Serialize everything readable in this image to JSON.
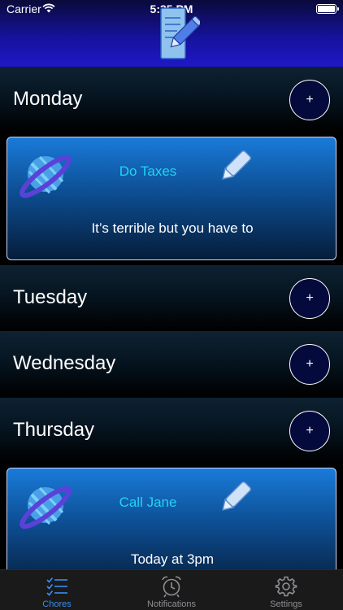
{
  "status_bar": {
    "carrier": "Carrier",
    "time": "5:35 PM"
  },
  "header": {
    "logo_icon": "notepad-pencil-icon"
  },
  "days": [
    {
      "name": "Monday",
      "add_label": "+",
      "chores": [
        {
          "title": "Do Taxes",
          "description": "It’s terrible but you have to"
        }
      ]
    },
    {
      "name": "Tuesday",
      "add_label": "+",
      "chores": []
    },
    {
      "name": "Wednesday",
      "add_label": "+",
      "chores": []
    },
    {
      "name": "Thursday",
      "add_label": "+",
      "chores": [
        {
          "title": "Call Jane",
          "description": "Today at 3pm"
        }
      ]
    }
  ],
  "tabbar": {
    "tabs": [
      {
        "label": "Chores",
        "icon": "checklist-icon",
        "active": true
      },
      {
        "label": "Notifications",
        "icon": "alarm-clock-icon",
        "active": false
      },
      {
        "label": "Settings",
        "icon": "gear-icon",
        "active": false
      }
    ]
  },
  "colors": {
    "accent": "#3b8cf0",
    "chore_title": "#23d3f2",
    "card_top": "#1a7bd9",
    "header_bottom": "#1e18c8"
  }
}
